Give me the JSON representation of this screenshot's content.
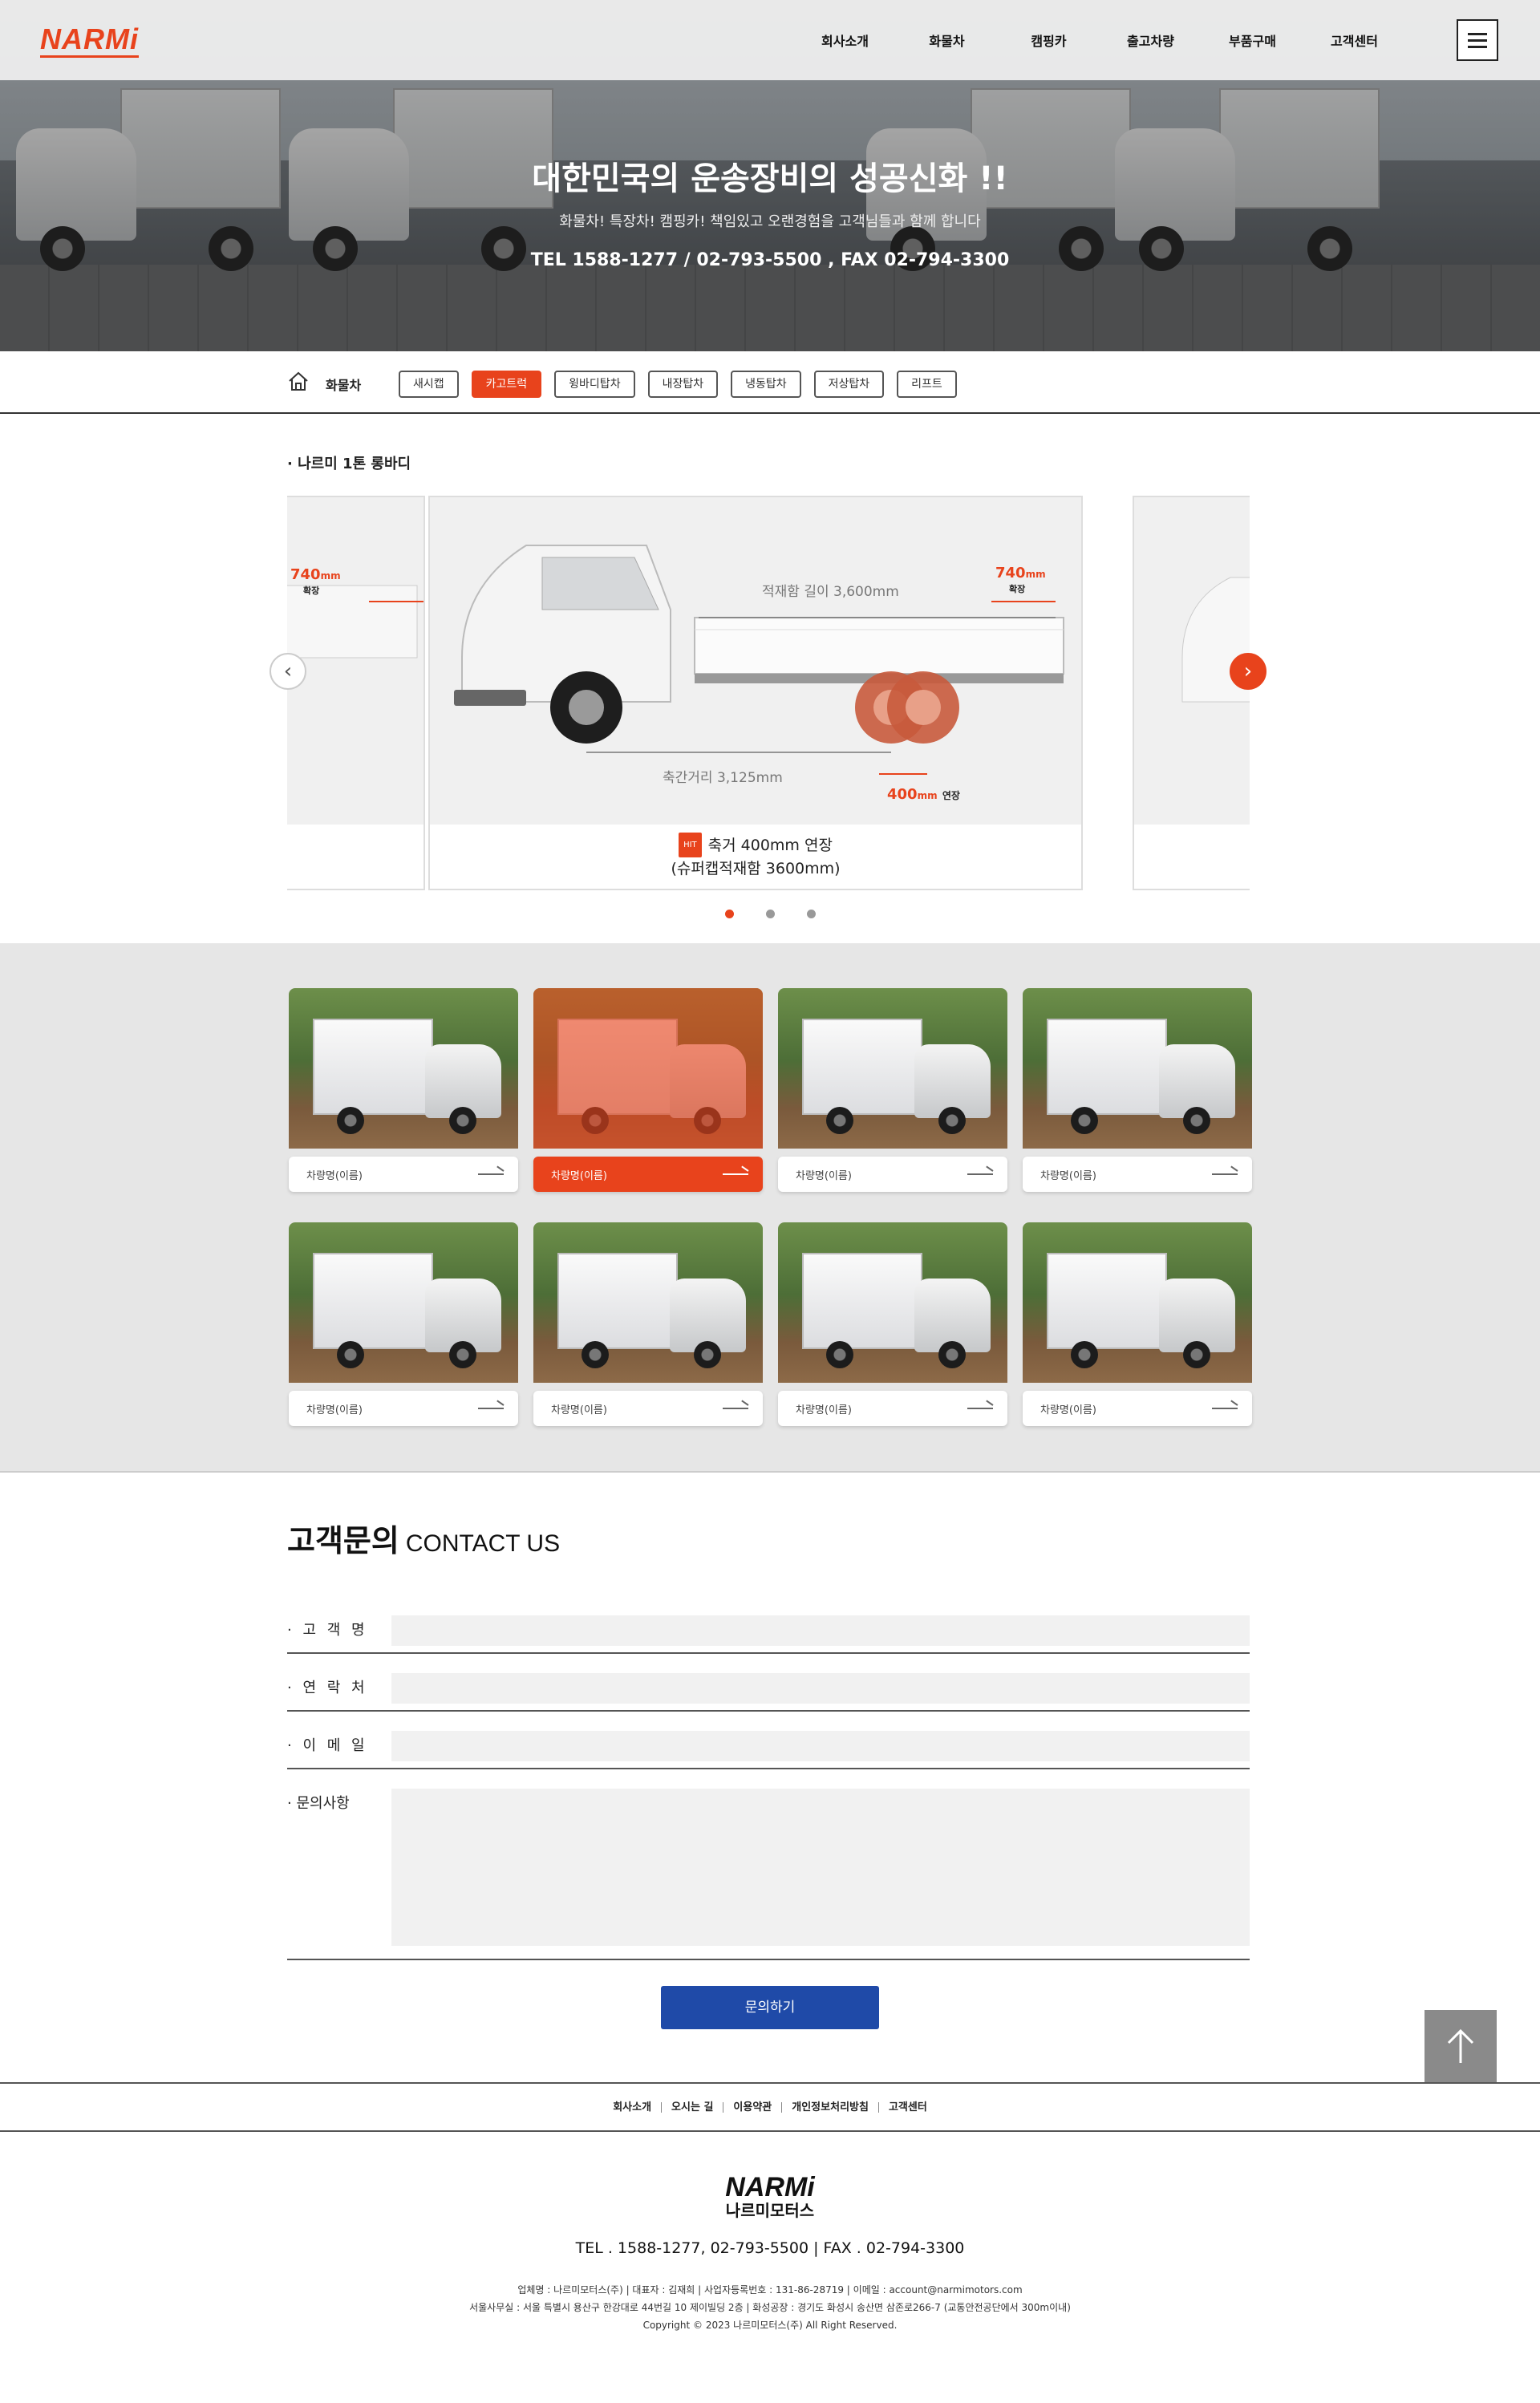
{
  "header": {
    "logo": "NARMi",
    "nav": [
      "회사소개",
      "화물차",
      "캠핑카",
      "출고차량",
      "부품구매",
      "고객센터"
    ]
  },
  "hero": {
    "title": "대한민국의 운송장비의 성공신화 !!",
    "subtitle": "화물차! 특장차! 캠핑카! 책임있고 오랜경험을 고객님들과 함께 합니다",
    "tel": "TEL  1588-1277 / 02-793-5500 , FAX  02-794-3300"
  },
  "subnav": {
    "title": "화물차",
    "chips": [
      "새시캡",
      "카고트럭",
      "윙바디탑차",
      "내장탑차",
      "냉동탑차",
      "저상탑차",
      "리프트"
    ],
    "active_index": 1
  },
  "product": {
    "section_label": "· 나르미 1톤 롱바디",
    "slide": {
      "badge": "HIT",
      "caption_line1": "축거 400mm 연장",
      "caption_line2": "(슈퍼캡적재함 3600mm)",
      "dim_cargo": "적재함 길이 3,600mm",
      "dim_ext": "740",
      "dim_ext_unit": "mm",
      "dim_ext_note": "확장",
      "dim_wheelbase": "축간거리 3,125mm",
      "dim_axle": "400",
      "dim_axle_unit": "mm",
      "dim_axle_note": "연장"
    },
    "prev_icon": "‹",
    "next_icon": "›",
    "dots": 3,
    "active_dot": 0
  },
  "gallery": {
    "items": [
      {
        "name": "차량명(이름)"
      },
      {
        "name": "차량명(이름)"
      },
      {
        "name": "차량명(이름)"
      },
      {
        "name": "차량명(이름)"
      },
      {
        "name": "차량명(이름)"
      },
      {
        "name": "차량명(이름)"
      },
      {
        "name": "차량명(이름)"
      },
      {
        "name": "차량명(이름)"
      }
    ],
    "active_index": 1
  },
  "contact": {
    "title": "고객문의",
    "title_en": "CONTACT US",
    "fields": [
      {
        "label": "· 고 객 명",
        "value": ""
      },
      {
        "label": "· 연 락 처",
        "value": ""
      },
      {
        "label": "· 이 메 일",
        "value": ""
      },
      {
        "label": "· 문의사항",
        "value": ""
      }
    ],
    "submit": "문의하기"
  },
  "footer": {
    "links": [
      "회사소개",
      "오시는 길",
      "이용약관",
      "개인정보처리방침",
      "고객센터"
    ],
    "logo_en": "NARMi",
    "logo_ko": "나르미모터스",
    "tel": "TEL . 1588-1277,  02-793-5500   |   FAX . 02-794-3300",
    "info1": "업체명 : 나르미모터스(주)   |   대표자 : 김재희   |   사업자등록번호 : 131-86-28719   |   이메일 : account@narmimotors.com",
    "info2": "서울사무실 : 서울 특별시 용산구 한강대로 44번길 10 제이빌딩 2층   |   화성공장 : 경기도 화성시 송산면 삼존로266-7 (교통안전공단에서 300m이내)",
    "copyright": "Copyright © 2023 나르미모터스(주) All Right Reserved."
  }
}
